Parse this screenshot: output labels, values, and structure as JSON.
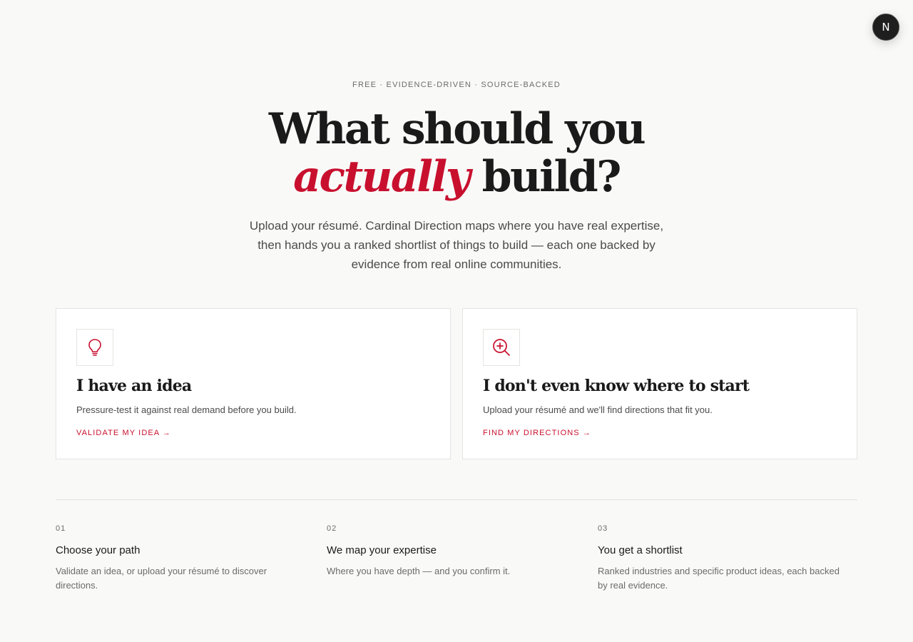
{
  "header": {
    "avatar_initial": "N"
  },
  "hero": {
    "eyebrow": "FREE · EVIDENCE-DRIVEN · SOURCE-BACKED",
    "headline_line1": "What should you",
    "headline_accent": "actually",
    "headline_rest": " build?",
    "lead": "Upload your résumé. Cardinal Direction maps where you have real expertise, then hands you a ranked shortlist of things to build — each one backed by evidence from real online communities."
  },
  "cards": [
    {
      "icon": "lightbulb-icon",
      "title": "I have an idea",
      "description": "Pressure-test it against real demand before you build.",
      "link": "VALIDATE MY IDEA →"
    },
    {
      "icon": "search-plus-icon",
      "title": "I don't even know where to start",
      "description": "Upload your résumé and we'll find directions that fit you.",
      "link": "FIND MY DIRECTIONS →"
    }
  ],
  "steps": [
    {
      "number": "01",
      "title": "Choose your path",
      "description": "Validate an idea, or upload your résumé to discover directions."
    },
    {
      "number": "02",
      "title": "We map your expertise",
      "description": "Where you have depth — and you confirm it."
    },
    {
      "number": "03",
      "title": "You get a shortlist",
      "description": "Ranked industries and specific product ideas, each backed by real evidence."
    }
  ],
  "colors": {
    "accent": "#c8102e",
    "background": "#f9f9f8",
    "text": "#1a1a1a",
    "muted": "#6b6b6b"
  }
}
